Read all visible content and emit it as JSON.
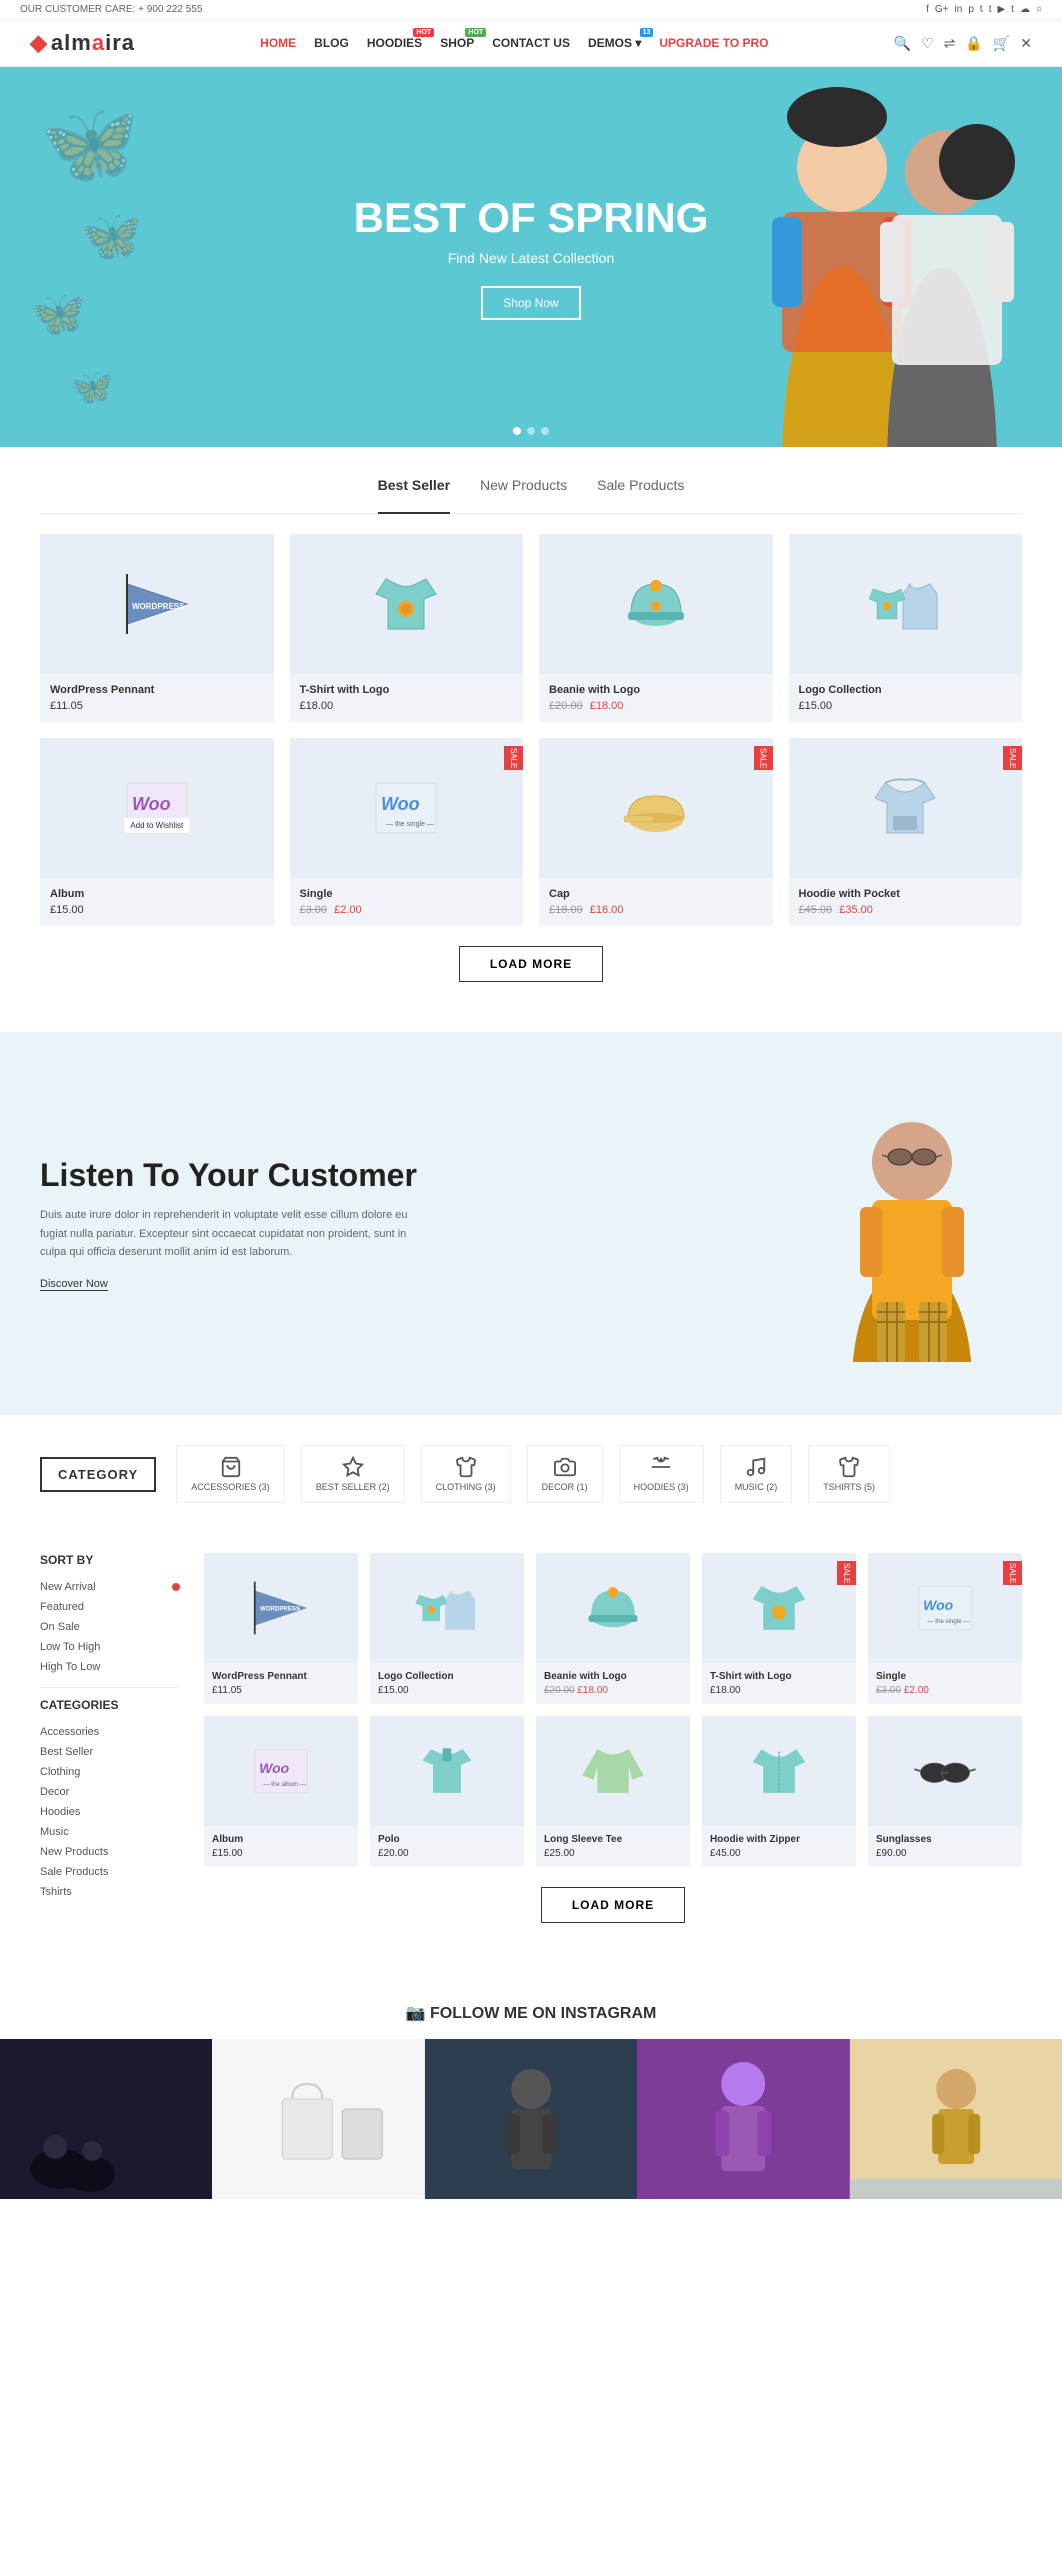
{
  "topbar": {
    "phone_label": "OUR CUSTOMER CARE: + 900 222 555",
    "social_icons": [
      "f",
      "G+",
      "in",
      "p",
      "t",
      "t",
      "y",
      "t",
      "s",
      "o"
    ]
  },
  "header": {
    "logo": "almaira",
    "nav": [
      {
        "label": "HOME",
        "active": true,
        "badge": null
      },
      {
        "label": "BLOG",
        "active": false,
        "badge": null
      },
      {
        "label": "HOODIES",
        "active": false,
        "badge": {
          "text": "HOT",
          "color": "red"
        }
      },
      {
        "label": "SHOP",
        "active": false,
        "badge": {
          "text": "HOT",
          "color": "green"
        }
      },
      {
        "label": "CONTACT US",
        "active": false,
        "badge": null
      },
      {
        "label": "DEMOS",
        "active": false,
        "badge": {
          "text": "13",
          "color": "blue"
        },
        "has_dropdown": true
      },
      {
        "label": "UPGRADE TO PRO",
        "active": false,
        "badge": null
      }
    ]
  },
  "hero": {
    "title": "BEST OF SPRING",
    "subtitle": "Find New Latest Collection",
    "cta": "Shop Now",
    "dots": 3
  },
  "products_section": {
    "tabs": [
      {
        "label": "Best Seller",
        "active": true
      },
      {
        "label": "New Products",
        "active": false
      },
      {
        "label": "Sale Products",
        "active": false
      }
    ],
    "products": [
      {
        "name": "WordPress Pennant",
        "price": "£11.05",
        "old_price": null,
        "badge": null,
        "type": "pennant"
      },
      {
        "name": "T-Shirt with Logo",
        "price": "£18.00",
        "old_price": null,
        "badge": null,
        "type": "tshirt"
      },
      {
        "name": "Beanie with Logo",
        "price": "£18.00",
        "old_price": "£20.00",
        "badge": null,
        "type": "beanie"
      },
      {
        "name": "Logo Collection",
        "price": "£15.00",
        "old_price": null,
        "badge": null,
        "type": "collection"
      },
      {
        "name": "Album",
        "price": "£15.00",
        "old_price": null,
        "badge": null,
        "type": "woo-album"
      },
      {
        "name": "Single",
        "price": "£2.00",
        "old_price": "£3.00",
        "badge": "SALE",
        "type": "woo-single"
      },
      {
        "name": "Cap",
        "price": "£16.00",
        "old_price": "£18.00",
        "badge": "SALE",
        "type": "cap"
      },
      {
        "name": "Hoodie with Pocket",
        "price": "£35.00",
        "old_price": "£45.00",
        "badge": "SALE",
        "type": "hoodie"
      }
    ],
    "load_more": "LOAD MORE"
  },
  "listen_banner": {
    "title": "Listen To Your Customer",
    "body": "Duis aute irure dolor in reprehenderit in voluptate velit esse cillum dolore eu fugiat nulla pariatur. Excepteur sint occaecat cupidatat non proident, sunt in culpa qui officia deserunt mollit anim id est laborum.",
    "cta": "Discover Now"
  },
  "category_section": {
    "label": "CATEGORY",
    "tabs": [
      {
        "label": "ACCESSORIES (3)",
        "icon": "bag"
      },
      {
        "label": "BEST SELLER (2)",
        "icon": "star"
      },
      {
        "label": "CLOTHING (3)",
        "icon": "shirt"
      },
      {
        "label": "DECOR (1)",
        "icon": "camera"
      },
      {
        "label": "HOODIES (3)",
        "icon": "hanger"
      },
      {
        "label": "MUSIC (2)",
        "icon": "music"
      },
      {
        "label": "TSHIRTS (5)",
        "icon": "tshirt"
      }
    ]
  },
  "shop_section": {
    "sort_by": {
      "title": "SORT BY",
      "options": [
        {
          "label": "New Arrival",
          "active": true
        },
        {
          "label": "Featured",
          "active": false
        },
        {
          "label": "On Sale",
          "active": false
        },
        {
          "label": "Low To High",
          "active": false
        },
        {
          "label": "High To Low",
          "active": false
        }
      ]
    },
    "categories": {
      "title": "CATEGORIES",
      "items": [
        {
          "label": "Accessories",
          "count": null
        },
        {
          "label": "Best Seller",
          "count": null
        },
        {
          "label": "Clothing",
          "count": null
        },
        {
          "label": "Decor",
          "count": null
        },
        {
          "label": "Hoodies",
          "count": null
        },
        {
          "label": "Music",
          "count": null
        },
        {
          "label": "New Products",
          "count": null
        },
        {
          "label": "Sale Products",
          "count": null
        },
        {
          "label": "Tshirts",
          "count": null
        }
      ]
    },
    "products": [
      {
        "name": "WordPress Pennant",
        "price": "£11.05",
        "old_price": null,
        "badge": null,
        "type": "pennant"
      },
      {
        "name": "Logo Collection",
        "price": "£15.00",
        "old_price": null,
        "badge": null,
        "type": "collection"
      },
      {
        "name": "Beanie with Logo",
        "price": "£18.00",
        "old_price": "£20.00",
        "badge": null,
        "type": "beanie"
      },
      {
        "name": "T-Shirt with Logo",
        "price": "£18.00",
        "old_price": null,
        "badge": "SALE",
        "type": "tshirt"
      },
      {
        "name": "Single",
        "price": "£2.00",
        "old_price": "£3.00",
        "badge": "SALE",
        "type": "woo-single"
      },
      {
        "name": "Album",
        "price": "£15.00",
        "old_price": null,
        "badge": null,
        "type": "woo-album"
      },
      {
        "name": "Polo",
        "price": "£20.00",
        "old_price": null,
        "badge": null,
        "type": "polo"
      },
      {
        "name": "Long Sleeve Tee",
        "price": "£25.00",
        "old_price": null,
        "badge": null,
        "type": "longsleeve"
      },
      {
        "name": "Hoodie with Zipper",
        "price": "£45.00",
        "old_price": null,
        "badge": null,
        "type": "hoodie"
      },
      {
        "name": "Sunglasses",
        "price": "£90.00",
        "old_price": null,
        "badge": null,
        "type": "sunglasses"
      }
    ],
    "load_more": "LOAD MORE"
  },
  "instagram": {
    "title": "FOLLOW ME ON INSTAGRAM",
    "icon": "instagram-icon"
  }
}
